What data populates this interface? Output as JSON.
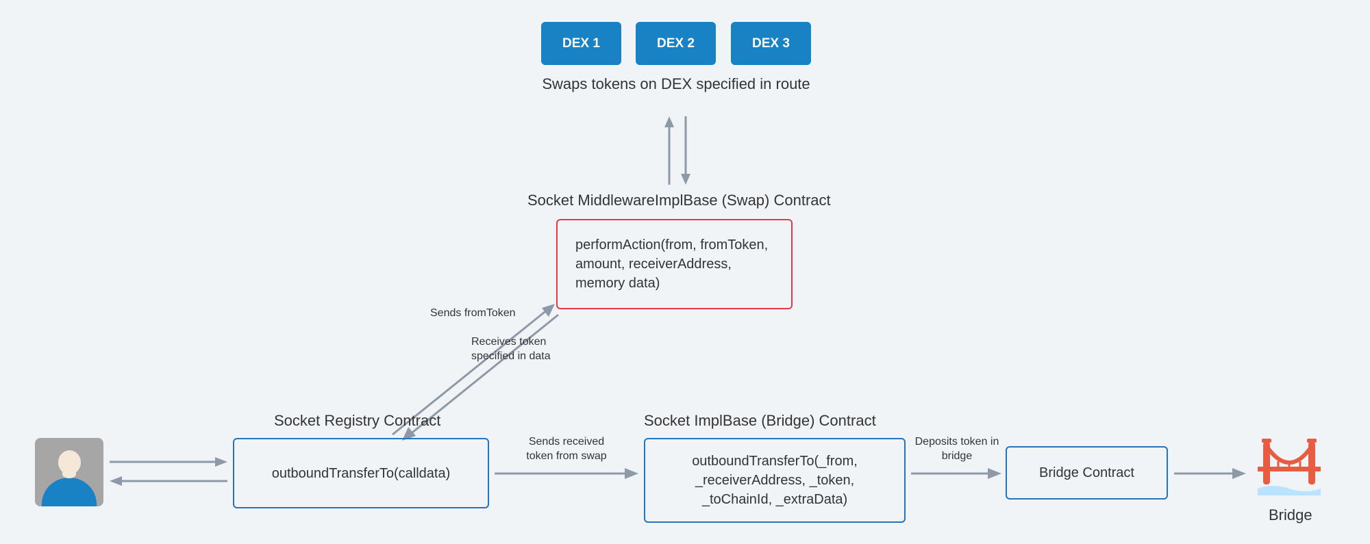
{
  "dex": {
    "d1": "DEX 1",
    "d2": "DEX 2",
    "d3": "DEX 3"
  },
  "labels": {
    "swaps": "Swaps tokens on DEX specified in route",
    "middleware_title": "Socket MiddlewareImplBase (Swap) Contract",
    "registry_title": "Socket Registry Contract",
    "implbase_title": "Socket ImplBase (Bridge) Contract",
    "bridge_label": "Bridge",
    "sends_from": "Sends fromToken",
    "receives_token": "Receives token specified in data",
    "sends_received": "Sends received token from swap",
    "deposits": "Deposits token in bridge"
  },
  "boxes": {
    "perform_action": "performAction(from, fromToken, amount, receiverAddress, memory data)",
    "registry": "outboundTransferTo(calldata)",
    "implbase": "outboundTransferTo(_from, _receiverAddress, _token, _toChainId, _extraData)",
    "bridge_contract": "Bridge Contract"
  }
}
